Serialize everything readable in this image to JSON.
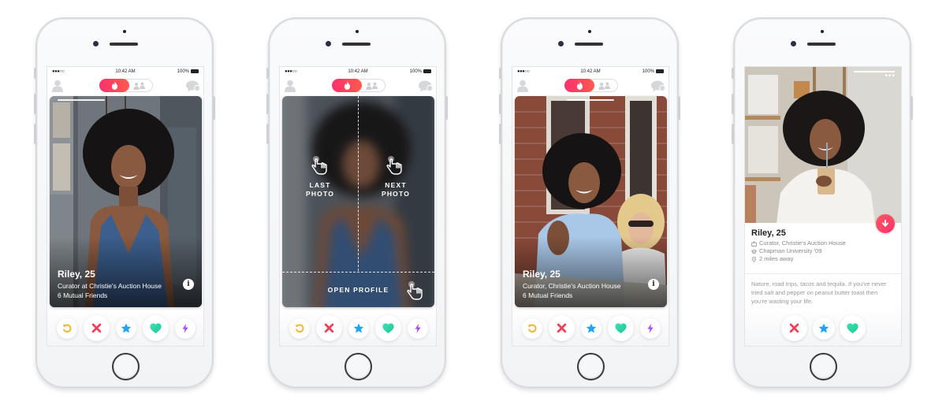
{
  "colors": {
    "brand_gradient_start": "#fd2f6d",
    "brand_gradient_end": "#ff5b4c",
    "rewind": "#f5b530",
    "nope": "#f0415b",
    "superlike": "#1ea5f6",
    "like": "#2ed6a2",
    "boost": "#a44df0"
  },
  "status_bar": {
    "signal": "●●●○○",
    "time": "10:42 AM",
    "battery": "100%"
  },
  "header": {
    "left_icon": "profile-icon",
    "toggle_active_icon": "flame-icon",
    "toggle_inactive_icon": "social-group-icon",
    "right_icon": "chat-icon"
  },
  "actions": {
    "rewind": "rewind-icon",
    "nope": "x-icon",
    "superlike": "star-icon",
    "like": "heart-icon",
    "boost": "lightning-icon"
  },
  "screens": [
    {
      "id": "card",
      "name": "Riley, 25",
      "line1": "Curator at Christie's Auction House",
      "line2": "6 Mutual Friends",
      "info_icon": "i"
    },
    {
      "id": "tutorial",
      "left_label_1": "LAST",
      "left_label_2": "PHOTO",
      "right_label_1": "NEXT",
      "right_label_2": "PHOTO",
      "bottom_label": "OPEN PROFILE"
    },
    {
      "id": "card-2",
      "name": "Riley, 25",
      "line1": "Curator, Christie's Auction House",
      "line2": "6 Mutual Friends",
      "info_icon": "i"
    },
    {
      "id": "profile",
      "more_label": "•••",
      "name": "Riley, 25",
      "job": "Curator, Christie's Auction House",
      "school": "Chapman University '09",
      "distance": "2 miles away",
      "bio": "Nature, road trips, tacos and tequila. If you've never tried salt and pepper on peanut butter toast then you're wasting your life."
    }
  ]
}
